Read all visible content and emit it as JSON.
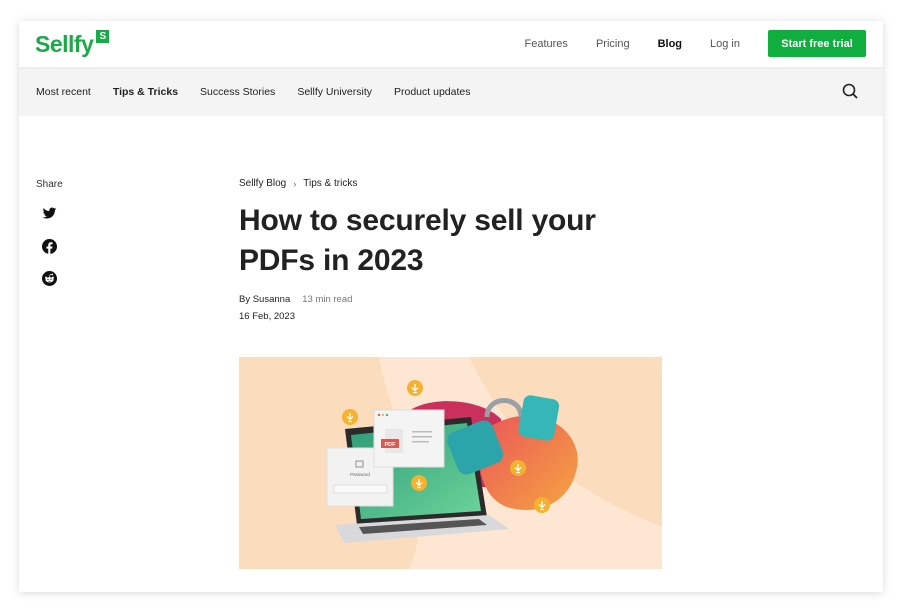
{
  "header": {
    "logo_text": "Sellfy",
    "logo_badge": "S",
    "nav": [
      {
        "label": "Features",
        "active": false
      },
      {
        "label": "Pricing",
        "active": false
      },
      {
        "label": "Blog",
        "active": true
      },
      {
        "label": "Log in",
        "active": false
      }
    ],
    "cta_label": "Start free trial"
  },
  "subnav": {
    "items": [
      {
        "label": "Most recent",
        "active": false
      },
      {
        "label": "Tips & Tricks",
        "active": true
      },
      {
        "label": "Success Stories",
        "active": false
      },
      {
        "label": "Sellfy University",
        "active": false
      },
      {
        "label": "Product updates",
        "active": false
      }
    ],
    "search_icon": "search-icon"
  },
  "share": {
    "label": "Share",
    "icons": [
      "twitter-icon",
      "facebook-icon",
      "reddit-icon"
    ]
  },
  "article": {
    "breadcrumb": [
      "Sellfy Blog",
      "Tips & tricks"
    ],
    "breadcrumb_separator": "›",
    "title": "How to securely sell your PDFs in 2023",
    "author": "By Susanna",
    "read_time": "13 min read",
    "date": "16 Feb, 2023",
    "hero": {
      "password_label": "Password",
      "password_value": "•••••",
      "pdf_label": "PDF"
    }
  },
  "colors": {
    "brand_green": "#1aaa48",
    "cta_green": "#0fae3f",
    "subnav_bg": "#f4f4f4",
    "hero_bg": "#fbdcbd"
  }
}
